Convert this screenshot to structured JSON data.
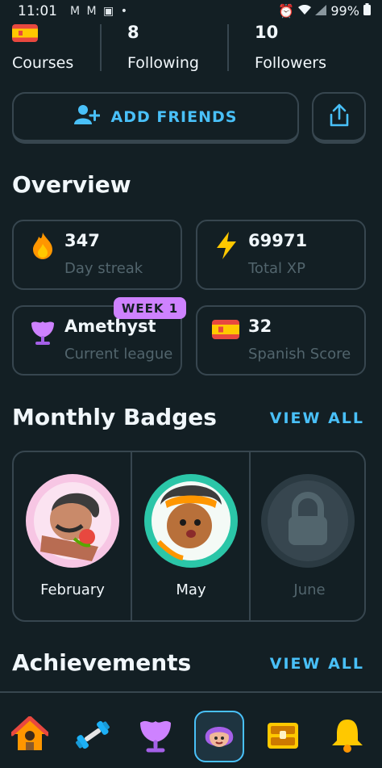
{
  "status_bar": {
    "time": "11:01",
    "left_icons": "M M ▣ •",
    "battery": "99%"
  },
  "profile_stats": {
    "courses_label": "Courses",
    "following_value": "8",
    "following_label": "Following",
    "followers_value": "10",
    "followers_label": "Followers"
  },
  "actions": {
    "add_friends_label": "ADD FRIENDS"
  },
  "overview": {
    "title": "Overview",
    "cards": [
      {
        "value": "347",
        "label": "Day streak",
        "icon": "fire-icon"
      },
      {
        "value": "69971",
        "label": "Total XP",
        "icon": "lightning-icon"
      },
      {
        "value": "Amethyst",
        "label": "Current league",
        "icon": "amethyst-league-icon",
        "badge": "WEEK 1"
      },
      {
        "value": "32",
        "label": "Spanish Score",
        "icon": "spain-flag-icon"
      }
    ]
  },
  "monthly_badges": {
    "title": "Monthly Badges",
    "view_all": "VIEW ALL",
    "items": [
      {
        "label": "February",
        "locked": false
      },
      {
        "label": "May",
        "locked": false
      },
      {
        "label": "June",
        "locked": true
      }
    ]
  },
  "achievements": {
    "title": "Achievements",
    "view_all": "VIEW ALL"
  },
  "bottom_nav": [
    {
      "icon": "home-icon",
      "selected": false
    },
    {
      "icon": "dumbbell-icon",
      "selected": false
    },
    {
      "icon": "league-icon",
      "selected": false
    },
    {
      "icon": "profile-avatar-icon",
      "selected": true
    },
    {
      "icon": "treasure-chest-icon",
      "selected": false
    },
    {
      "icon": "bell-icon",
      "selected": false
    }
  ],
  "colors": {
    "background": "#131f24",
    "border": "#37464f",
    "accent_blue": "#49c0f8",
    "league_purple": "#ce82ff",
    "muted_text": "#52656d"
  }
}
